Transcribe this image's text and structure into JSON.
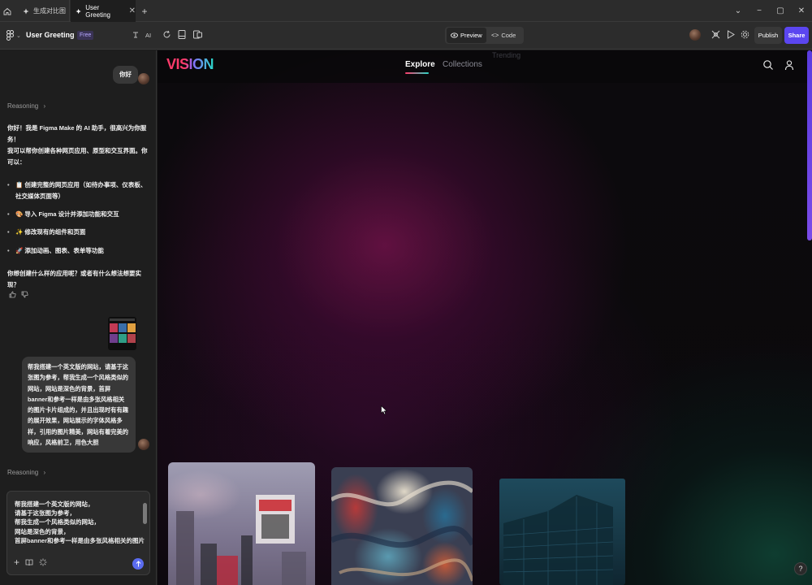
{
  "tabs": [
    {
      "label": "生成对比图"
    },
    {
      "label": "User Greeting"
    }
  ],
  "toolbar": {
    "project_name": "User Greeting",
    "plan_badge": "Free",
    "ai_label": "AI",
    "preview_label": "Preview",
    "code_label": "Code",
    "publish_label": "Publish",
    "share_label": "Share"
  },
  "chat": {
    "greeting_user": "你好",
    "reasoning_label": "Reasoning",
    "assistant_intro": "你好！我是 Figma Make 的 AI 助手，很高兴为你服务！",
    "assistant_capabilities": "我可以帮你创建各种网页应用、原型和交互界面。你可以：",
    "bullets": [
      "📋 创建完整的网页应用（如待办事项、仪表板、社交媒体页面等）",
      "🎨 导入 Figma 设计并添加功能和交互",
      "✨ 修改现有的组件和页面",
      "🚀 添加动画、图表、表单等功能"
    ],
    "assistant_question": "你想创建什么样的应用呢？或者有什么想法想要实现？",
    "user_request": "帮我搭建一个英文版的网站，请基于这张图为参考，帮我生成一个风格类似的网站，网站是深色的背景，首屏banner和参考一样是由多张风格相关的图片卡片组成的，并且出现时有有趣的展开效果，网站展示的字体风格多样，引用的图片精美，网站有着完美的响应，风格前卫，用色大胆",
    "reasoning_label_2": "Reasoning",
    "composer_text": "帮我搭建一个英文版的网站，\n请基于这张图为参考，\n帮我生成一个风格类似的网站，\n网站是深色的背景，\n首屏banner和参考一样是由多张风格相关的图片"
  },
  "site": {
    "logo": "VISION",
    "nav_explore": "Explore",
    "nav_collections": "Collections",
    "nav_trending": "Trending"
  },
  "help_label": "?"
}
